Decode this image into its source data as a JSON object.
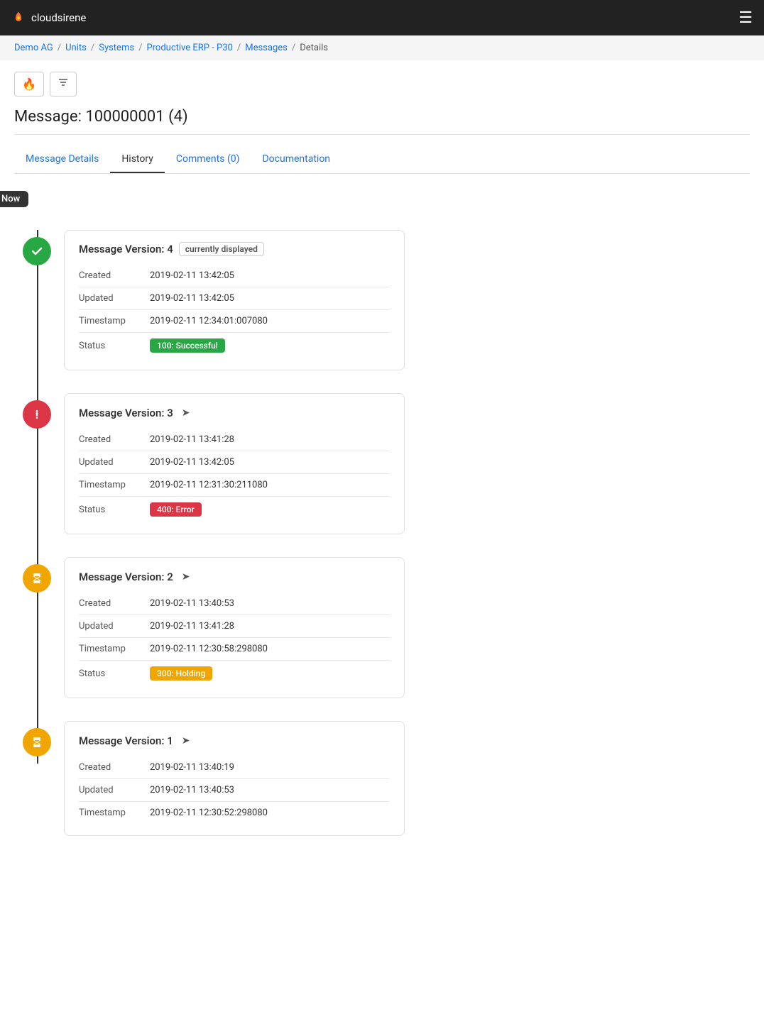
{
  "brand": {
    "name": "cloudsirene",
    "icon": "flame"
  },
  "breadcrumb": {
    "items": [
      {
        "label": "Demo AG",
        "href": "#"
      },
      {
        "label": "Units",
        "href": "#"
      },
      {
        "label": "Systems",
        "href": "#"
      },
      {
        "label": "Productive ERP - P30",
        "href": "#"
      },
      {
        "label": "Messages",
        "href": "#"
      },
      {
        "label": "Details",
        "href": null
      }
    ]
  },
  "page_title": "Message: 100000001 (4)",
  "tabs": [
    {
      "label": "Message Details",
      "active": false
    },
    {
      "label": "History",
      "active": true
    },
    {
      "label": "Comments (0)",
      "active": false
    },
    {
      "label": "Documentation",
      "active": false
    }
  ],
  "timeline": {
    "now_label": "Now",
    "versions": [
      {
        "version": 4,
        "icon": "checkmark",
        "icon_type": "green",
        "is_current": true,
        "current_label": "currently displayed",
        "fields": [
          {
            "label": "Created",
            "value": "2019-02-11 13:42:05"
          },
          {
            "label": "Updated",
            "value": "2019-02-11 13:42:05"
          },
          {
            "label": "Timestamp",
            "value": "2019-02-11 12:34:01:007080"
          },
          {
            "label": "Status",
            "value": "100: Successful",
            "badge": "success"
          }
        ]
      },
      {
        "version": 3,
        "icon": "warning",
        "icon_type": "red",
        "is_current": false,
        "fields": [
          {
            "label": "Created",
            "value": "2019-02-11 13:41:28"
          },
          {
            "label": "Updated",
            "value": "2019-02-11 13:42:05"
          },
          {
            "label": "Timestamp",
            "value": "2019-02-11 12:31:30:211080"
          },
          {
            "label": "Status",
            "value": "400: Error",
            "badge": "error"
          }
        ]
      },
      {
        "version": 2,
        "icon": "hourglass",
        "icon_type": "orange",
        "is_current": false,
        "fields": [
          {
            "label": "Created",
            "value": "2019-02-11 13:40:53"
          },
          {
            "label": "Updated",
            "value": "2019-02-11 13:41:28"
          },
          {
            "label": "Timestamp",
            "value": "2019-02-11 12:30:58:298080"
          },
          {
            "label": "Status",
            "value": "300: Holding",
            "badge": "holding"
          }
        ]
      },
      {
        "version": 1,
        "icon": "hourglass",
        "icon_type": "orange",
        "is_current": false,
        "partial": true,
        "fields": [
          {
            "label": "Created",
            "value": "2019-02-11 13:40:19"
          },
          {
            "label": "Updated",
            "value": "2019-02-11 13:40:53"
          },
          {
            "label": "Timestamp",
            "value": "2019-02-11 12:30:52:298080"
          }
        ]
      }
    ]
  },
  "toolbar": {
    "fire_btn": "🔥",
    "filter_btn": "⚙"
  }
}
